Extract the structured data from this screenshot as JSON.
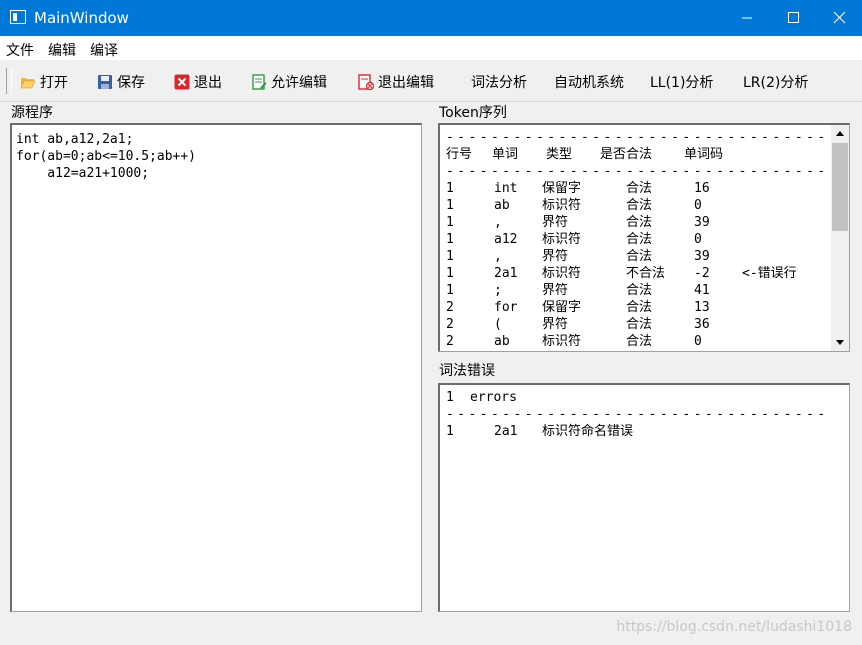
{
  "window": {
    "title": "MainWindow"
  },
  "menu": [
    "文件",
    "编辑",
    "编译"
  ],
  "toolbar": {
    "open": "打开",
    "save": "保存",
    "exit": "退出",
    "allow_edit": "允许编辑",
    "exit_edit": "退出编辑",
    "lexical": "词法分析",
    "automaton": "自动机系统",
    "ll1": "LL(1)分析",
    "lr2": "LR(2)分析"
  },
  "source": {
    "label": "源程序",
    "lines": [
      "int ab,a12,2a1;",
      "for(ab=0;ab<=10.5;ab++)",
      "    a12=a21+1000;"
    ]
  },
  "tokens": {
    "label": "Token序列",
    "headers": [
      "行号",
      "单词",
      "类型",
      "是否合法",
      "单词码"
    ],
    "rows": [
      {
        "line": "1",
        "word": "int",
        "type": "保留字",
        "valid": "合法",
        "code": "16",
        "note": ""
      },
      {
        "line": "1",
        "word": "ab",
        "type": "标识符",
        "valid": "合法",
        "code": "0",
        "note": ""
      },
      {
        "line": "1",
        "word": ",",
        "type": "界符",
        "valid": "合法",
        "code": "39",
        "note": ""
      },
      {
        "line": "1",
        "word": "a12",
        "type": "标识符",
        "valid": "合法",
        "code": "0",
        "note": ""
      },
      {
        "line": "1",
        "word": ",",
        "type": "界符",
        "valid": "合法",
        "code": "39",
        "note": ""
      },
      {
        "line": "1",
        "word": "2a1",
        "type": "标识符",
        "valid": "不合法",
        "code": "-2",
        "note": "<-错误行"
      },
      {
        "line": "1",
        "word": ";",
        "type": "界符",
        "valid": "合法",
        "code": "41",
        "note": ""
      },
      {
        "line": "2",
        "word": "for",
        "type": "保留字",
        "valid": "合法",
        "code": "13",
        "note": ""
      },
      {
        "line": "2",
        "word": "(",
        "type": "界符",
        "valid": "合法",
        "code": "36",
        "note": ""
      },
      {
        "line": "2",
        "word": "ab",
        "type": "标识符",
        "valid": "合法",
        "code": "0",
        "note": ""
      }
    ]
  },
  "errors": {
    "label": "词法错误",
    "count": "1",
    "count_label": "errors",
    "rows": [
      {
        "line": "1",
        "word": "2a1",
        "message": "标识符命名错误"
      }
    ]
  },
  "watermark": "https://blog.csdn.net/ludashi1018"
}
